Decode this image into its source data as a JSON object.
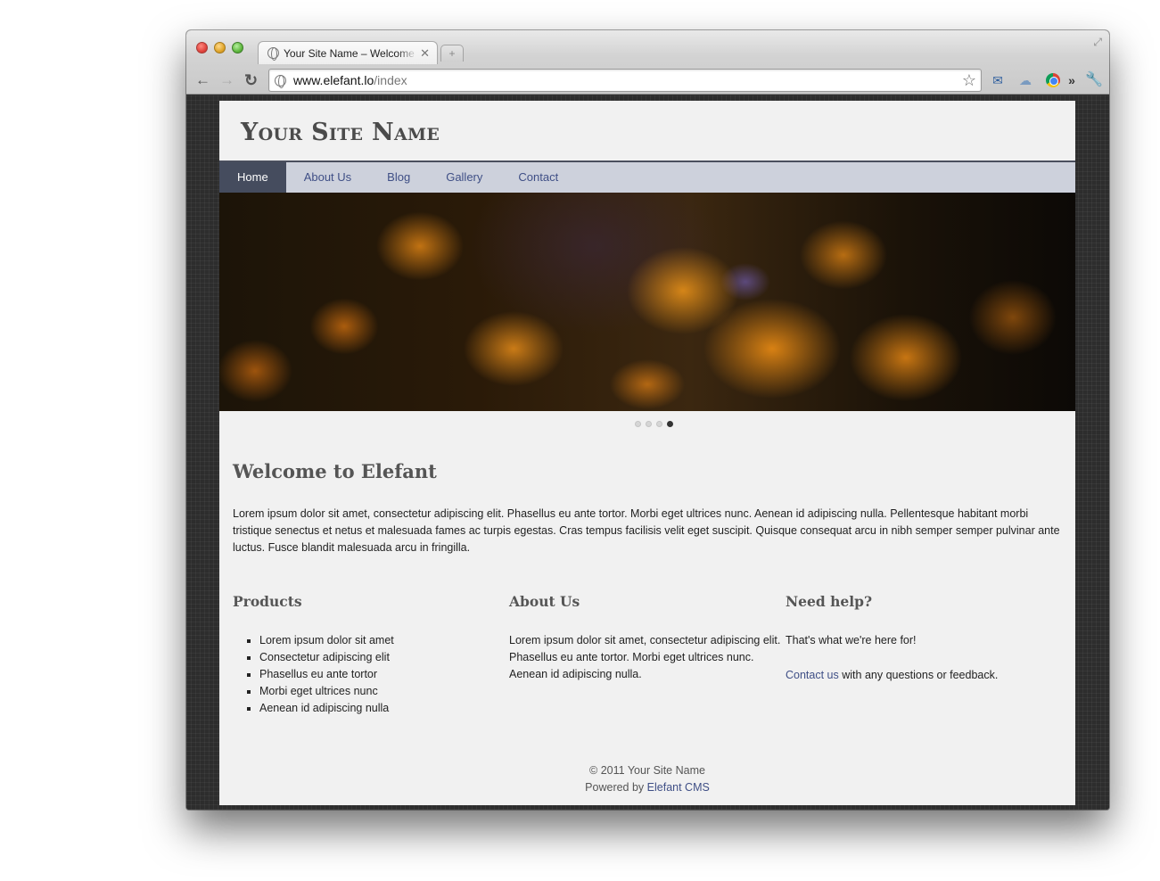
{
  "browser": {
    "tab_title": "Your Site Name – Welcome to Elefant",
    "url_host": "www.elefant.lo",
    "url_path": "/index"
  },
  "site": {
    "title": "Your Site Name",
    "nav": [
      "Home",
      "About Us",
      "Blog",
      "Gallery",
      "Contact"
    ],
    "active_nav": "Home",
    "slider": {
      "slides": 4,
      "active_slide": 4
    },
    "welcome_title": "Welcome to Elefant",
    "intro": "Lorem ipsum dolor sit amet, consectetur adipiscing elit. Phasellus eu ante tortor. Morbi eget ultrices nunc. Aenean id adipiscing nulla. Pellentesque habitant morbi tristique senectus et netus et malesuada fames ac turpis egestas. Cras tempus facilisis velit eget suscipit. Quisque consequat arcu in nibh semper semper pulvinar ante luctus. Fusce blandit malesuada arcu in fringilla.",
    "products": {
      "title": "Products",
      "items": [
        "Lorem ipsum dolor sit amet",
        "Consectetur adipiscing elit",
        "Phasellus eu ante tortor",
        "Morbi eget ultrices nunc",
        "Aenean id adipiscing nulla"
      ]
    },
    "about": {
      "title": "About Us",
      "text": "Lorem ipsum dolor sit amet, consectetur adipiscing elit. Phasellus eu ante tortor. Morbi eget ultrices nunc. Aenean id adipiscing nulla."
    },
    "help": {
      "title": "Need help?",
      "text1": "That's what we're here for!",
      "contact_link": "Contact us",
      "contact_rest": " with any questions or feedback."
    },
    "footer": {
      "copyright": "© 2011 Your Site Name",
      "powered_prefix": "Powered by ",
      "powered_link": "Elefant CMS"
    }
  },
  "colors": {
    "nav_bg": "#cdd1dc",
    "nav_active_bg": "#454c5e",
    "link": "#3f4f86"
  }
}
